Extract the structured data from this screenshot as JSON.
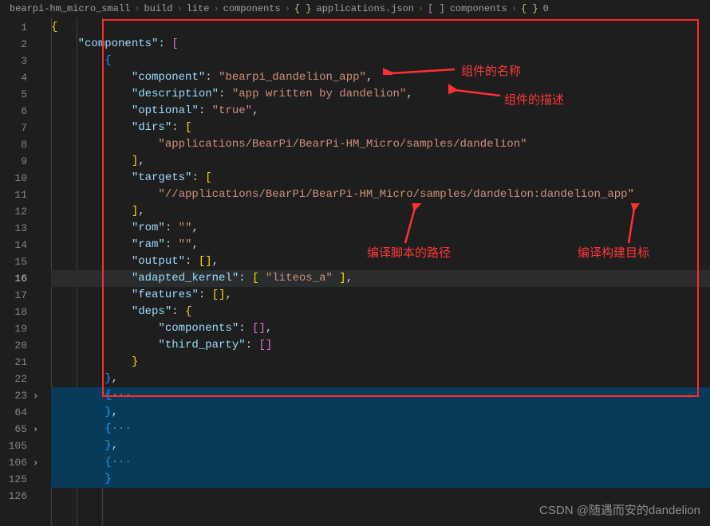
{
  "breadcrumb": {
    "p0": "bearpi-hm_micro_small",
    "p1": "build",
    "p2": "lite",
    "p3": "components",
    "p4": "applications.json",
    "p5": "components",
    "p6": "0",
    "ico_braces": "{ }",
    "ico_array": "[ ]"
  },
  "gutter": {
    "l1": "1",
    "l2": "2",
    "l3": "3",
    "l4": "4",
    "l5": "5",
    "l6": "6",
    "l7": "7",
    "l8": "8",
    "l9": "9",
    "l10": "10",
    "l11": "11",
    "l12": "12",
    "l13": "13",
    "l14": "14",
    "l15": "15",
    "l16": "16",
    "l17": "17",
    "l18": "18",
    "l19": "19",
    "l20": "20",
    "l21": "21",
    "l22": "22",
    "l23": "23",
    "l64": "64",
    "l65": "65",
    "l105": "105",
    "l106": "106",
    "l125": "125",
    "l126": "126"
  },
  "code": {
    "k_components": "\"components\"",
    "k_component": "\"component\"",
    "k_description": "\"description\"",
    "k_optional": "\"optional\"",
    "k_dirs": "\"dirs\"",
    "k_targets": "\"targets\"",
    "k_rom": "\"rom\"",
    "k_ram": "\"ram\"",
    "k_output": "\"output\"",
    "k_adapted_kernel": "\"adapted_kernel\"",
    "k_features": "\"features\"",
    "k_deps": "\"deps\"",
    "k_d_components": "\"components\"",
    "k_d_third_party": "\"third_party\"",
    "v_component": "\"bearpi_dandelion_app\"",
    "v_description": "\"app written by dandelion\"",
    "v_true": "\"true\"",
    "v_dir": "\"applications/BearPi/BearPi-HM_Micro/samples/dandelion\"",
    "v_target": "\"//applications/BearPi/BearPi-HM_Micro/samples/dandelion:dandelion_app\"",
    "v_empty": "\"\"",
    "v_liteos": "\"liteos_a\"",
    "ellipsis": "···"
  },
  "annotations": {
    "name": "组件的名称",
    "desc": "组件的描述",
    "path": "编译脚本的路径",
    "target": "编译构建目标"
  },
  "watermark": "CSDN @随遇而安的dandelion"
}
